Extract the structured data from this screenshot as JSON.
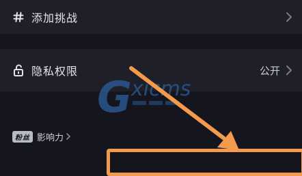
{
  "settings": {
    "rows": [
      {
        "icon": "hash-icon",
        "label": "添加挑战",
        "value": ""
      },
      {
        "icon": "unlock-icon",
        "label": "隐私权限",
        "value": "公开"
      }
    ]
  },
  "influence": {
    "badge": "粉丝",
    "label": "影响力"
  },
  "watermark": {
    "letter": "G",
    "text": "xicms"
  },
  "colors": {
    "background": "#15161d",
    "row_background": "#1e1f28",
    "annotation": "#f39a4d",
    "watermark": "#2b5e9c"
  }
}
